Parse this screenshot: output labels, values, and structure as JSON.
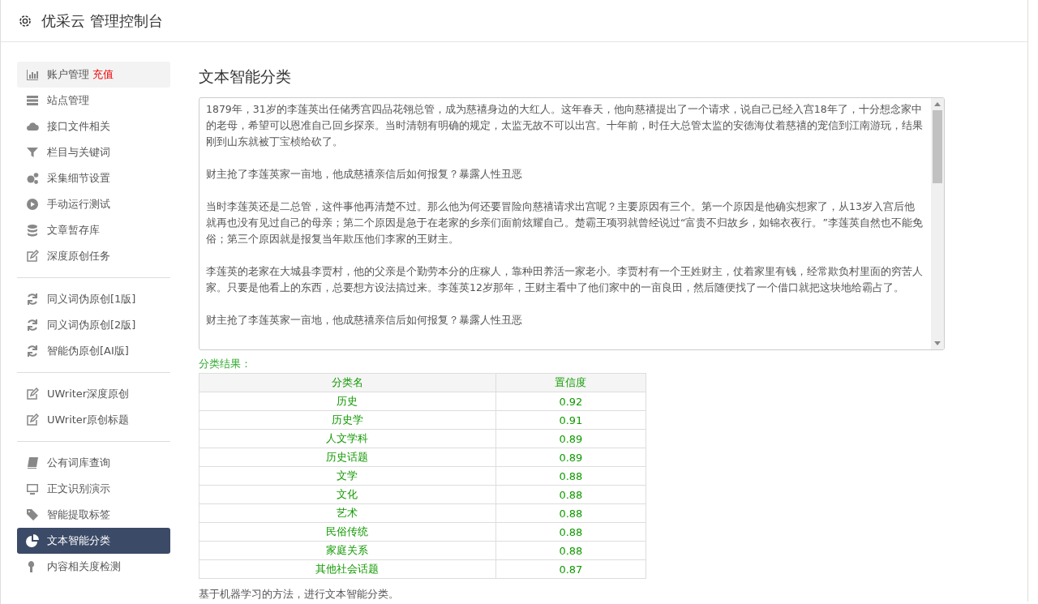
{
  "header": {
    "title": "优采云 管理控制台"
  },
  "sidebar": {
    "groups": [
      [
        {
          "label": "账户管理",
          "badge": "充值",
          "selected": false,
          "hovered": true
        },
        {
          "label": "站点管理",
          "selected": false,
          "hovered": false
        },
        {
          "label": "接口文件相关",
          "selected": false,
          "hovered": false
        },
        {
          "label": "栏目与关键词",
          "selected": false,
          "hovered": false
        },
        {
          "label": "采集细节设置",
          "selected": false,
          "hovered": false
        },
        {
          "label": "手动运行测试",
          "selected": false,
          "hovered": false
        },
        {
          "label": "文章暂存库",
          "selected": false,
          "hovered": false
        },
        {
          "label": "深度原创任务",
          "selected": false,
          "hovered": false
        }
      ],
      [
        {
          "label": "同义词伪原创[1版]",
          "selected": false,
          "hovered": false
        },
        {
          "label": "同义词伪原创[2版]",
          "selected": false,
          "hovered": false
        },
        {
          "label": "智能伪原创[AI版]",
          "selected": false,
          "hovered": false
        }
      ],
      [
        {
          "label": "UWriter深度原创",
          "selected": false,
          "hovered": false
        },
        {
          "label": "UWriter原创标题",
          "selected": false,
          "hovered": false
        }
      ],
      [
        {
          "label": "公有词库查询",
          "selected": false,
          "hovered": false
        },
        {
          "label": "正文识别演示",
          "selected": false,
          "hovered": false
        },
        {
          "label": "智能提取标签",
          "selected": false,
          "hovered": false
        },
        {
          "label": "文本智能分类",
          "selected": true,
          "hovered": false
        },
        {
          "label": "内容相关度检测",
          "selected": false,
          "hovered": false
        }
      ]
    ]
  },
  "main": {
    "title": "文本智能分类",
    "text_area": {
      "paragraphs": [
        "1879年，31岁的李莲英出任储秀宫四品花翎总管，成为慈禧身边的大红人。这年春天，他向慈禧提出了一个请求，说自己已经入宫18年了，十分想念家中的老母，希望可以恩准自己回乡探亲。当时清朝有明确的规定，太监无故不可以出宫。十年前，时任大总管太监的安德海仗着慈禧的宠信到江南游玩，结果刚到山东就被丁宝桢给砍了。",
        "财主抢了李莲英家一亩地，他成慈禧亲信后如何报复？暴露人性丑恶",
        "当时李莲英还是二总管，这件事他再清楚不过。那么他为何还要冒险向慈禧请求出宫呢？主要原因有三个。第一个原因是他确实想家了，从13岁入宫后他就再也没有见过自己的母亲；第二个原因是急于在老家的乡亲们面前炫耀自己。楚霸王项羽就曾经说过“富贵不归故乡，如锦衣夜行。”李莲英自然也不能免俗；第三个原因就是报复当年欺压他们李家的王财主。",
        "李莲英的老家在大城县李贾村，他的父亲是个勤劳本分的庄稼人，靠种田养活一家老小。李贾村有一个王姓财主，仗着家里有钱，经常欺负村里面的穷苦人家。只要是他看上的东西，总要想方设法搞过来。李莲英12岁那年，王财主看中了他们家中的一亩良田，然后随便找了一个借口就把这块地给霸占了。",
        "财主抢了李莲英家一亩地，他成慈禧亲信后如何报复？暴露人性丑恶"
      ]
    },
    "result_label": "分类结果：",
    "table": {
      "columns": [
        "分类名",
        "置信度"
      ],
      "rows": [
        [
          "历史",
          "0.92"
        ],
        [
          "历史学",
          "0.91"
        ],
        [
          "人文学科",
          "0.89"
        ],
        [
          "历史话题",
          "0.89"
        ],
        [
          "文学",
          "0.88"
        ],
        [
          "文化",
          "0.88"
        ],
        [
          "艺术",
          "0.88"
        ],
        [
          "民俗传统",
          "0.88"
        ],
        [
          "家庭关系",
          "0.88"
        ],
        [
          "其他社会话题",
          "0.87"
        ]
      ]
    },
    "footer_note": "基于机器学习的方法，进行文本智能分类。"
  }
}
